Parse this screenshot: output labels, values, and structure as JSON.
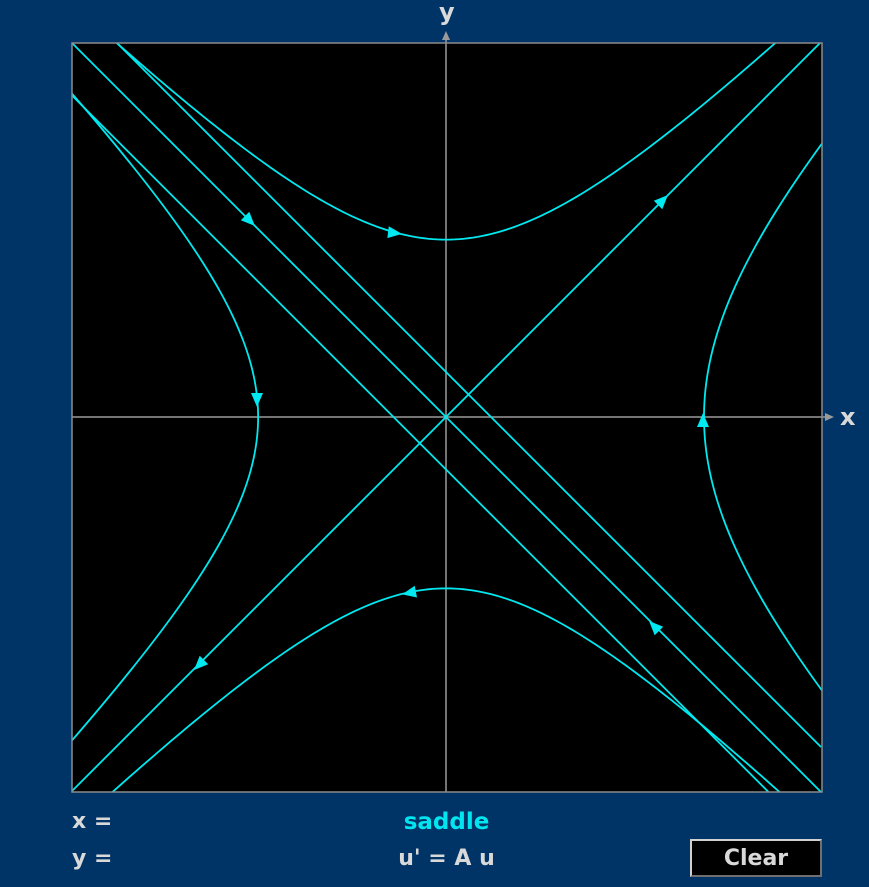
{
  "plot": {
    "x_axis_label": "x",
    "y_axis_label": "y",
    "background_color": "#000000",
    "frame_color": "#8c8c8c",
    "axis_color": "#9a9a9a",
    "trajectory_color": "#00e8f0",
    "phase_portrait_type": "saddle"
  },
  "readout": {
    "x_label": "x =",
    "y_label": "y ="
  },
  "system": {
    "type_label": "saddle",
    "equation": "u' = A u"
  },
  "controls": {
    "clear_label": "Clear"
  },
  "colors": {
    "page_background": "#003366",
    "type_label": "#00e5f0",
    "text": "#d9d9d9"
  }
}
